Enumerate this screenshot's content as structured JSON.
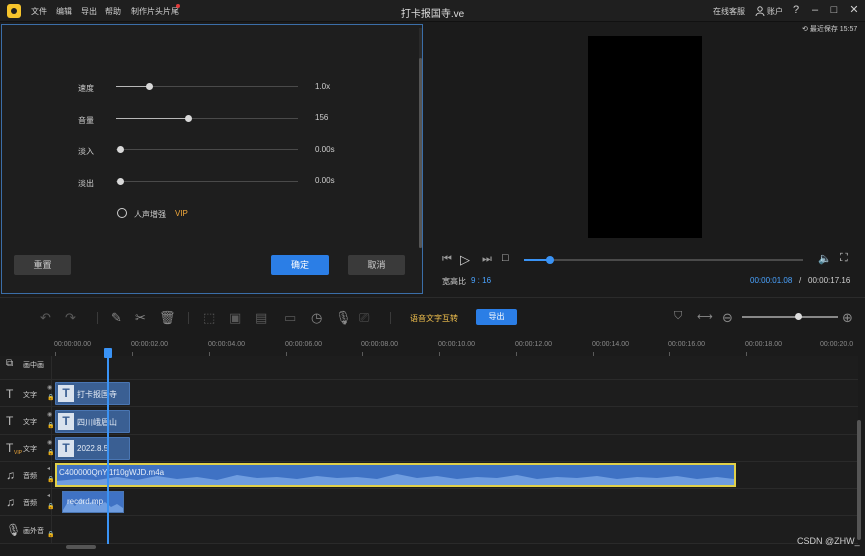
{
  "app": {
    "title": "打卡报国寺.ve",
    "menu": [
      "文件",
      "编辑",
      "导出",
      "帮助",
      "制作片头片尾"
    ],
    "support": "在线客服",
    "account": "账户"
  },
  "properties": {
    "speed": {
      "label": "速度",
      "value": "1.0x"
    },
    "volume": {
      "label": "音量",
      "value": "156"
    },
    "fade_in": {
      "label": "淡入",
      "value": "0.00s"
    },
    "fade_out": {
      "label": "淡出",
      "value": "0.00s"
    },
    "voice_enhance": {
      "label": "人声增强",
      "badge": "VIP"
    },
    "reset": "重置",
    "confirm": "确定",
    "cancel": "取消"
  },
  "preview": {
    "save_status": "最近保存 15:57",
    "ratio_label": "宽高比",
    "ratio_value": "9 : 16",
    "current_time": "00:00:01.08",
    "separator": "/",
    "total_time": "00:00:17.16",
    "progress_fraction": 0.08
  },
  "toolbar": {
    "speech_to_text": "语音文字互转",
    "export": "导出",
    "zoom_fraction": 0.58
  },
  "timeline": {
    "ticks": [
      "00:00:00.00",
      "00:00:02.00",
      "00:00:04.00",
      "00:00:06.00",
      "00:00:08.00",
      "00:00:10.00",
      "00:00:12.00",
      "00:00:14.00",
      "00:00:16.00",
      "00:00:18.00",
      "00:00:20.0"
    ],
    "tracks": [
      {
        "name": "画中画",
        "icon": "picture-in-picture-icon"
      },
      {
        "name": "文字",
        "icon": "text-icon",
        "clip": "打卡报国寺"
      },
      {
        "name": "文字",
        "icon": "text-icon",
        "clip": "四川峨眉山"
      },
      {
        "name": "文字",
        "icon": "text-icon",
        "clip": "2022.8.5",
        "tag": "VIP"
      },
      {
        "name": "音频",
        "icon": "music-note-icon",
        "clip": "C400000QnYi1f10gWJD.m4a"
      },
      {
        "name": "音频",
        "icon": "music-note-icon",
        "clip": "record.mp"
      },
      {
        "name": "画外音",
        "icon": "microphone-icon"
      }
    ]
  },
  "watermark": "CSDN @ZHW_"
}
